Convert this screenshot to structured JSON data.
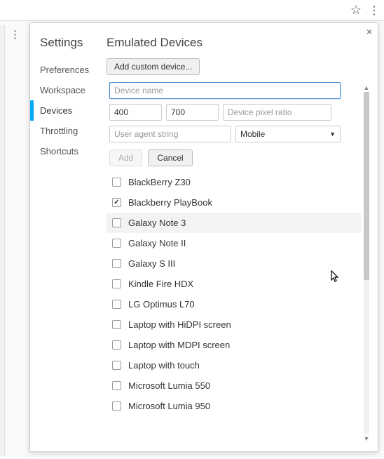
{
  "sidebar": {
    "title": "Settings",
    "items": [
      {
        "label": "Preferences"
      },
      {
        "label": "Workspace"
      },
      {
        "label": "Devices"
      },
      {
        "label": "Throttling"
      },
      {
        "label": "Shortcuts"
      }
    ]
  },
  "main": {
    "title": "Emulated Devices",
    "add_custom_label": "Add custom device..."
  },
  "form": {
    "device_name_placeholder": "Device name",
    "width_value": "400",
    "height_value": "700",
    "pixel_ratio_placeholder": "Device pixel ratio",
    "ua_placeholder": "User agent string",
    "type_value": "Mobile",
    "add_label": "Add",
    "cancel_label": "Cancel"
  },
  "devices": [
    {
      "label": "BlackBerry Z30",
      "checked": false,
      "hover": false
    },
    {
      "label": "Blackberry PlayBook",
      "checked": true,
      "hover": false
    },
    {
      "label": "Galaxy Note 3",
      "checked": false,
      "hover": true
    },
    {
      "label": "Galaxy Note II",
      "checked": false,
      "hover": false
    },
    {
      "label": "Galaxy S III",
      "checked": false,
      "hover": false
    },
    {
      "label": "Kindle Fire HDX",
      "checked": false,
      "hover": false
    },
    {
      "label": "LG Optimus L70",
      "checked": false,
      "hover": false
    },
    {
      "label": "Laptop with HiDPI screen",
      "checked": false,
      "hover": false
    },
    {
      "label": "Laptop with MDPI screen",
      "checked": false,
      "hover": false
    },
    {
      "label": "Laptop with touch",
      "checked": false,
      "hover": false
    },
    {
      "label": "Microsoft Lumia 550",
      "checked": false,
      "hover": false
    },
    {
      "label": "Microsoft Lumia 950",
      "checked": false,
      "hover": false
    }
  ]
}
